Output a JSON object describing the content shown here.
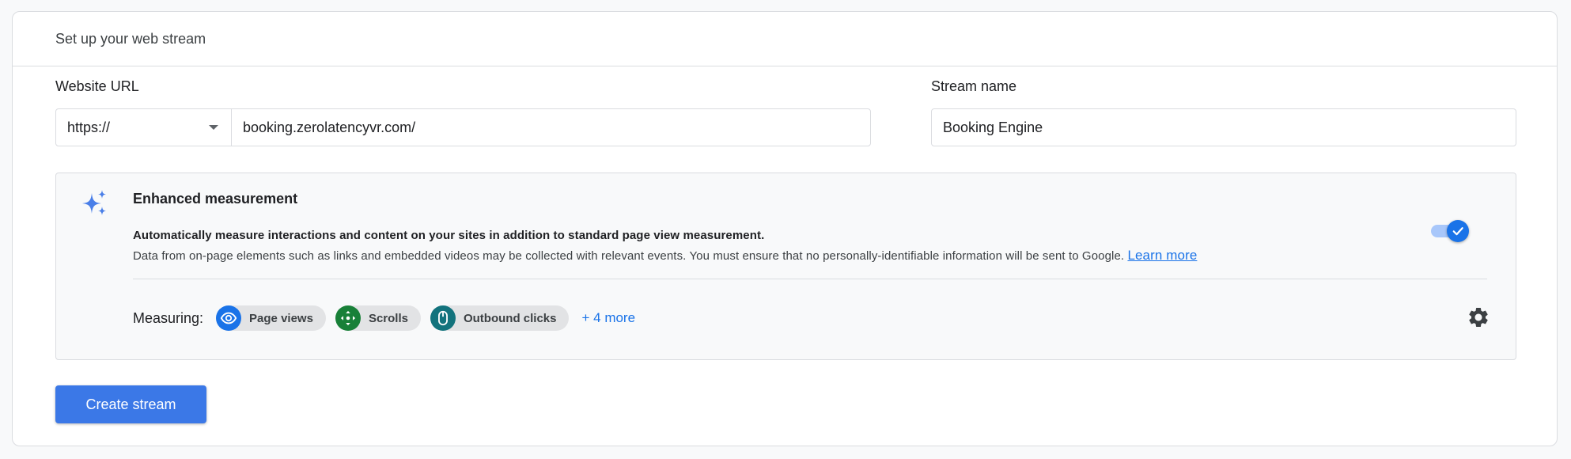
{
  "header": {
    "title": "Set up your web stream"
  },
  "website_url": {
    "label": "Website URL",
    "protocol": "https://",
    "value": "booking.zerolatencyvr.com/"
  },
  "stream_name": {
    "label": "Stream name",
    "value": "Booking Engine"
  },
  "enhanced_measurement": {
    "title": "Enhanced measurement",
    "description_bold": "Automatically measure interactions and content on your sites in addition to standard page view measurement.",
    "description": "Data from on-page elements such as links and embedded videos may be collected with relevant events. You must ensure that no personally-identifiable information will be sent to Google.",
    "learn_more": "Learn more",
    "enabled": true,
    "measuring_label": "Measuring:",
    "chips": [
      {
        "label": "Page views",
        "icon": "eye-icon",
        "color": "#1a73e8"
      },
      {
        "label": "Scrolls",
        "icon": "scroll-arrows-icon",
        "color": "#188038"
      },
      {
        "label": "Outbound clicks",
        "icon": "mouse-icon",
        "color": "#12737d"
      }
    ],
    "more": "+ 4 more"
  },
  "actions": {
    "create_label": "Create stream"
  },
  "colors": {
    "primary": "#1a73e8",
    "button": "#3b78e7",
    "border": "#dadce0"
  }
}
